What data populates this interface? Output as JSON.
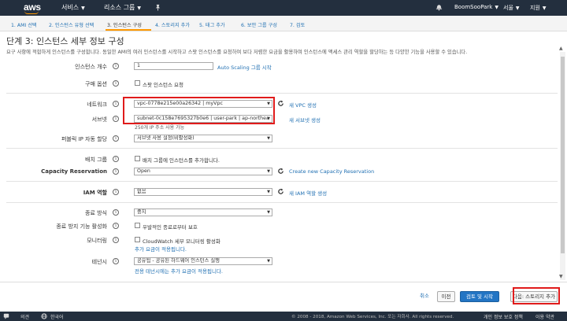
{
  "topnav": {
    "logo": "aws",
    "services": "서비스",
    "resource_groups": "리소스 그룹",
    "pin_icon": "pin-icon",
    "user": "BoomSooPark",
    "region": "서울",
    "support": "지원"
  },
  "steps": [
    {
      "label": "1. AMI 선택"
    },
    {
      "label": "2. 인스턴스 유형 선택"
    },
    {
      "label": "3. 인스턴스 구성"
    },
    {
      "label": "4. 스토리지 추가"
    },
    {
      "label": "5. 태그 추가"
    },
    {
      "label": "6. 보안 그룹 구성"
    },
    {
      "label": "7. 검토"
    }
  ],
  "page": {
    "title": "단계 3: 인스턴스 세부 정보 구성",
    "description": "요구 사항에 적합하게 인스턴스를 구성합니다. 동일한 AMI의 여러 인스턴스를 시작하고 스팟 인스턴스를 요청하여 보다 저렴한 요금을 활용하며 인스턴스에 액세스 관리 역할을 할당하는 등 다양한 기능을 사용할 수 있습니다."
  },
  "form": {
    "instance_count_label": "인스턴스 개수",
    "instance_count_value": "1",
    "auto_scaling_link": "Auto Scaling 그룹 시작",
    "purchase_label": "구매 옵션",
    "spot_label": "스팟 인스턴스 요청",
    "network_label": "네트워크",
    "network_value": "vpc-0778e215e00a26342 | myVpc",
    "new_vpc_link": "새 VPC 생성",
    "subnet_label": "서브넷",
    "subnet_value": "subnet-0c158e7695327b0e6 | user-park | ap-northea",
    "subnet_note": "250개 IP 주소 사용 가능",
    "new_subnet_link": "새 서브넷 생성",
    "public_ip_label": "퍼블릭 IP 자동 할당",
    "public_ip_value": "서브넷 사용 설정(비활성화)",
    "placement_label": "배치 그룹",
    "placement_check_label": "배치 그룹에 인스턴스를 추가합니다.",
    "capacity_label": "Capacity Reservation",
    "capacity_value": "Open",
    "capacity_link": "Create new Capacity Reservation",
    "iam_label": "IAM 역할",
    "iam_value": "없음",
    "iam_link": "새 IAM 역할 생성",
    "shutdown_label": "종료 방식",
    "shutdown_value": "중지",
    "termination_label": "종료 방지 기능 활성화",
    "termination_check_label": "우발적인 종료로부터 보호",
    "monitoring_label": "모니터링",
    "monitoring_check_label": "CloudWatch 세부 모니터링 활성화",
    "monitoring_note": "추가 요금이 적용됩니다.",
    "tenancy_label": "테넌시",
    "tenancy_value": "공유됨 - 공유된 하드웨어 인스턴스 실행",
    "tenancy_note": "전용 테넌시에는 추가 요금이 적용됩니다."
  },
  "actions": {
    "cancel": "취소",
    "previous": "이전",
    "review_launch": "검토 및 시작",
    "next": "다음: 스토리지 추가"
  },
  "footer": {
    "feedback": "의견",
    "language": "한국어",
    "copyright": "© 2008 - 2018, Amazon Web Services, Inc. 또는 자회사. All rights reserved.",
    "privacy": "개인 정보 보호 정책",
    "terms": "이용 약관"
  },
  "colors": {
    "nav_bg": "#232f3e",
    "accent_orange": "#ff9900",
    "link_blue": "#1f6fb2",
    "primary_button": "#2375c4",
    "highlight_red": "#e01b1b"
  }
}
